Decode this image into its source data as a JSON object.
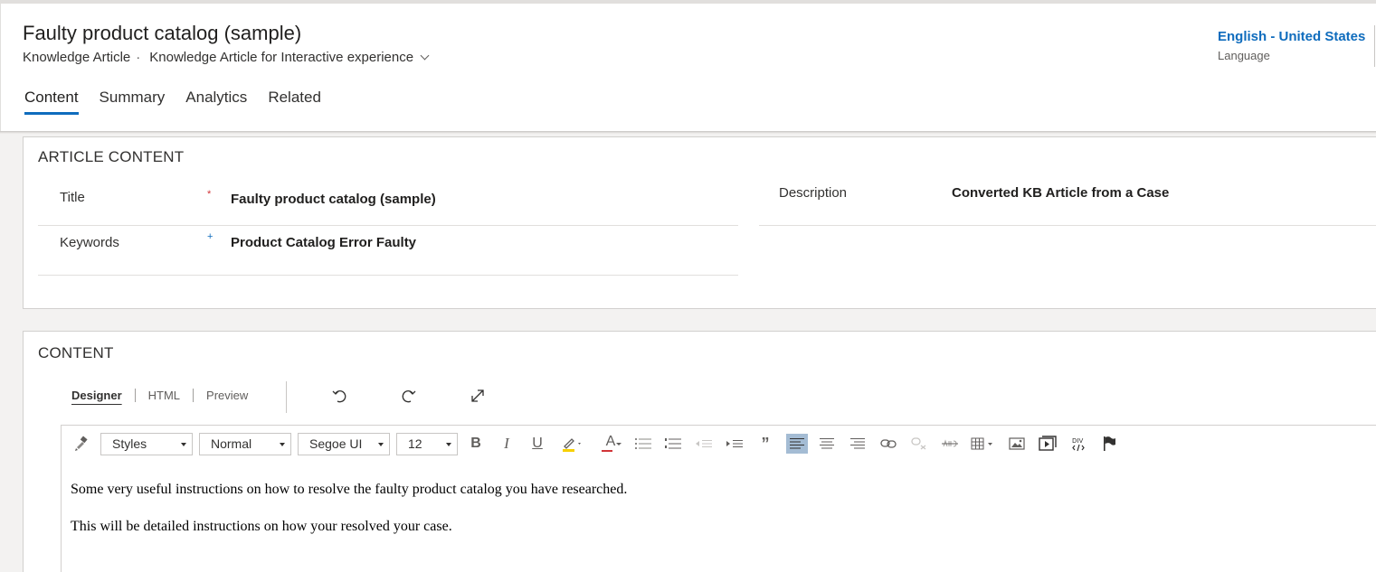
{
  "header": {
    "title": "Faulty product catalog (sample)",
    "entity": "Knowledge Article",
    "separator": "·",
    "form_selector": "Knowledge Article for Interactive experience",
    "language_value": "English - United States",
    "language_caption": "Language"
  },
  "tabs": [
    {
      "label": "Content",
      "active": true
    },
    {
      "label": "Summary",
      "active": false
    },
    {
      "label": "Analytics",
      "active": false
    },
    {
      "label": "Related",
      "active": false
    }
  ],
  "article_content": {
    "section_title": "ARTICLE CONTENT",
    "title_label": "Title",
    "title_required": "*",
    "title_value": "Faulty product catalog (sample)",
    "keywords_label": "Keywords",
    "keywords_recommended": "+",
    "keywords_value": "Product Catalog Error Faulty",
    "description_label": "Description",
    "description_value": "Converted KB Article from a Case"
  },
  "content": {
    "section_title": "CONTENT",
    "editor_tabs": [
      {
        "label": "Designer",
        "active": true
      },
      {
        "label": "HTML",
        "active": false
      },
      {
        "label": "Preview",
        "active": false
      }
    ],
    "toolbar": {
      "styles": "Styles",
      "format": "Normal",
      "font": "Segoe UI",
      "size": "12",
      "bold": "B",
      "italic": "I",
      "underline": "U",
      "font_color": "A",
      "blockquote": "”"
    },
    "body": [
      "Some very useful instructions on how to resolve the faulty product catalog you have researched.",
      "This will be detailed instructions on how your resolved your case."
    ]
  },
  "colors": {
    "accent": "#0f6cbd",
    "required": "#d13438",
    "recommended": "#0f6cbd",
    "selected_button": "#a4bcd4"
  }
}
